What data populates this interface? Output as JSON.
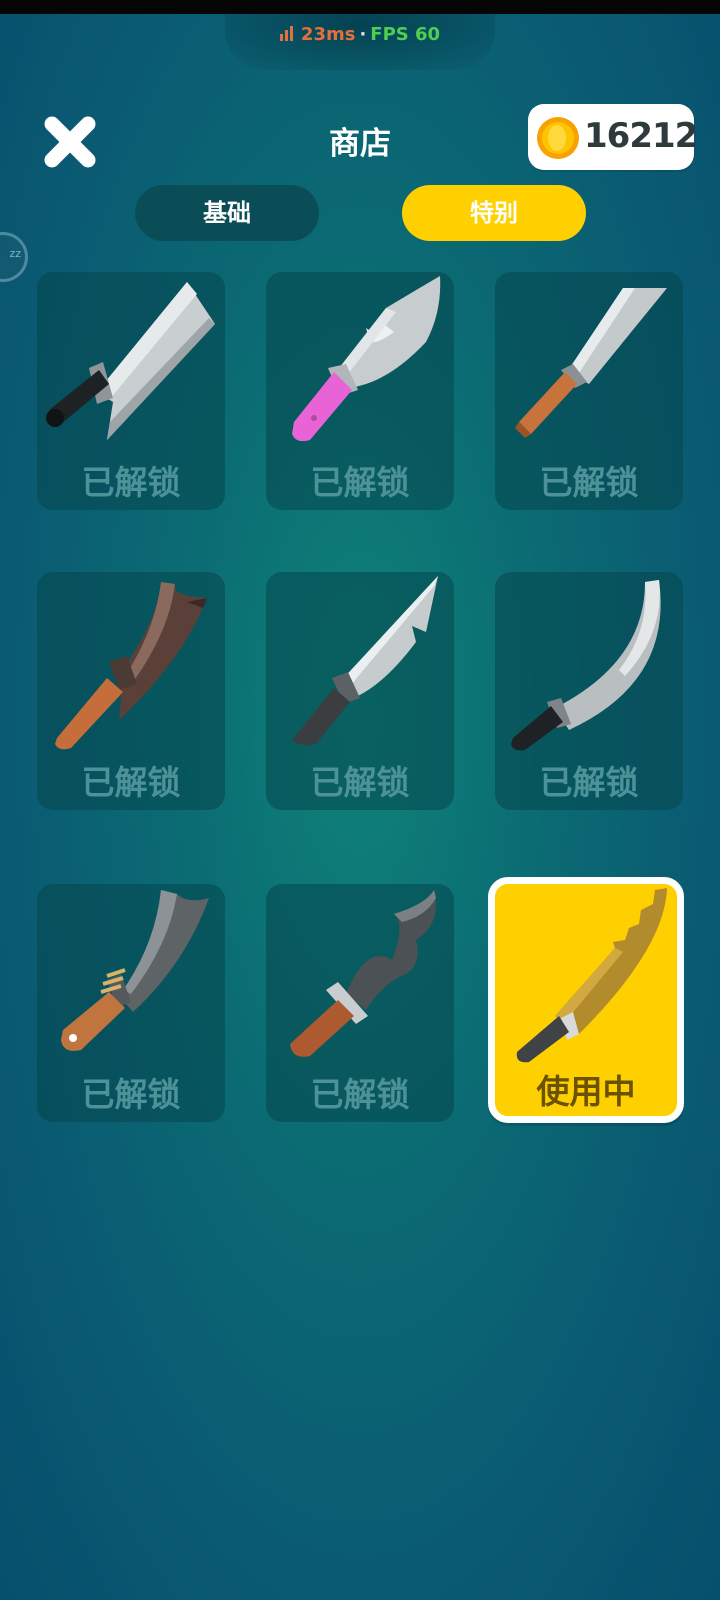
{
  "status": {
    "ping": "23ms",
    "separator": "·",
    "fps": "FPS 60",
    "ping_color": "#e46f3c",
    "fps_color": "#4fcf52"
  },
  "header": {
    "title": "商店",
    "close_icon": "close-icon",
    "coin_icon": "coin-icon",
    "coins": "16212"
  },
  "tabs": [
    {
      "label": "基础",
      "selected": false
    },
    {
      "label": "特别",
      "selected": true,
      "color": "#ffd000"
    }
  ],
  "items": [
    {
      "icon": "cleaver-knife-icon",
      "status": "已解锁",
      "selected": false
    },
    {
      "icon": "pink-hunting-knife-icon",
      "status": "已解锁",
      "selected": false
    },
    {
      "icon": "kitchen-knife-icon",
      "status": "已解锁",
      "selected": false
    },
    {
      "icon": "rusty-cleaver-icon",
      "status": "已解锁",
      "selected": false
    },
    {
      "icon": "spear-knife-icon",
      "status": "已解锁",
      "selected": false
    },
    {
      "icon": "curved-blade-icon",
      "status": "已解锁",
      "selected": false
    },
    {
      "icon": "machete-icon",
      "status": "已解锁",
      "selected": false
    },
    {
      "icon": "wavy-kris-icon",
      "status": "已解锁",
      "selected": false
    },
    {
      "icon": "golden-serrated-saw-icon",
      "status": "使用中",
      "selected": true
    }
  ]
}
